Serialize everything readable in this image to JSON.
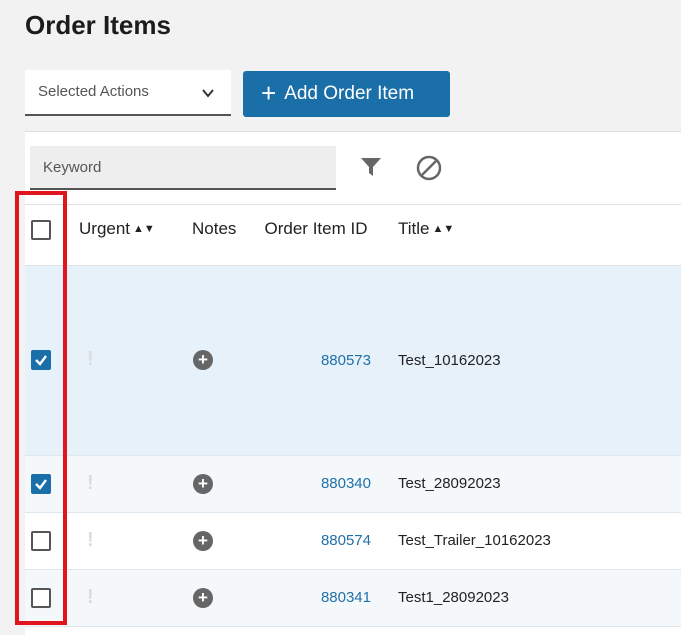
{
  "header": {
    "title": "Order Items"
  },
  "toolbar": {
    "actions_placeholder": "Selected Actions",
    "add_label": "Add Order Item"
  },
  "search": {
    "placeholder": "Keyword"
  },
  "table": {
    "columns": {
      "urgent": "Urgent",
      "notes": "Notes",
      "order_item_id": "Order Item ID",
      "title": "Title"
    },
    "rows": [
      {
        "checked": true,
        "order_item_id": "880573",
        "title": "Test_10162023"
      },
      {
        "checked": true,
        "order_item_id": "880340",
        "title": "Test_28092023"
      },
      {
        "checked": false,
        "order_item_id": "880574",
        "title": "Test_Trailer_10162023"
      },
      {
        "checked": false,
        "order_item_id": "880341",
        "title": "Test1_28092023"
      }
    ]
  },
  "colors": {
    "primary": "#1a6fa8",
    "highlight": "#e0151e",
    "selected_row": "#e6f1fa"
  }
}
